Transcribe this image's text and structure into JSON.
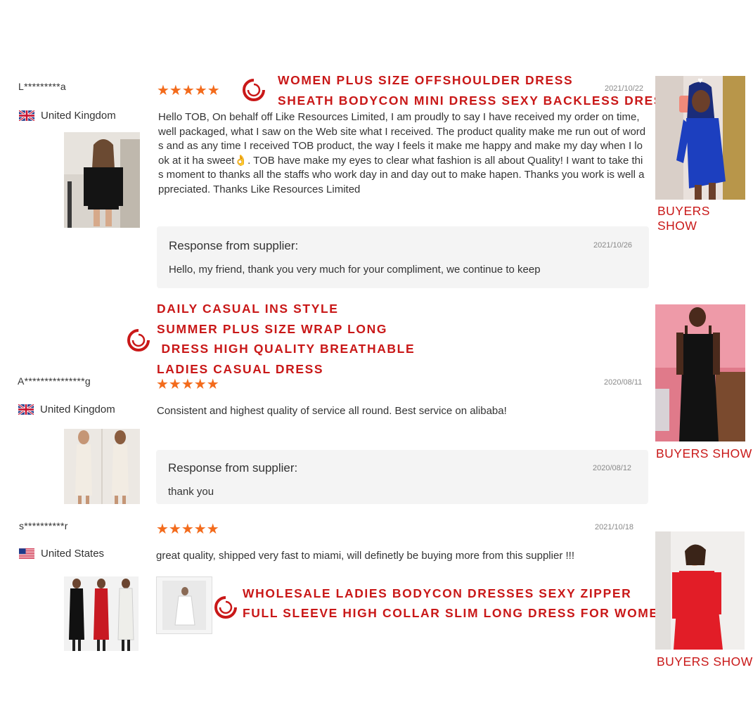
{
  "reviews": [
    {
      "reviewer": "L*********a",
      "country": "United Kingdom",
      "flag": "uk-flag-icon",
      "date": "2021/10/22",
      "text": "Hello TOB, On behalf off Like Resources Limited, I am proudly to say I have received my order on time, well packaged, what I saw on the Web site what I received. The product quality make me run out of words and as any time I received TOB product, the way I feels it make me happy and make my day when I look at it ha sweet👌. TOB have make my eyes to clear what fashion is all about Quality! I want to take this moment to thanks all the staffs who work day in and day out to make hapen. Thanks you work is well appreciated. Thanks Like Resources Limited",
      "response_title": "Response from supplier:",
      "response_date": "2021/10/26",
      "response_text": "Hello, my friend, thank you very much for your compliment, we continue to keep",
      "promo": [
        "WOMEN PLUS SIZE OFFSHOULDER DRESS",
        "SHEATH BODYCON MINI DRESS SEXY BACKLESS DRESS"
      ],
      "buyers_show": "BUYERS SHOW"
    },
    {
      "reviewer": "A***************g",
      "country": "United Kingdom",
      "flag": "uk-flag-icon",
      "date": "2020/08/11",
      "text": "Consistent and highest quality of service all round. Best service on alibaba!",
      "response_title": "Response from supplier:",
      "response_date": "2020/08/12",
      "response_text": "thank you",
      "promo": [
        "DAILY CASUAL INS STYLE",
        "SUMMER PLUS SIZE WRAP LONG",
        " DRESS HIGH QUALITY BREATHABLE",
        "LADIES CASUAL DRESS"
      ],
      "buyers_show": "BUYERS SHOW"
    },
    {
      "reviewer": "s**********r",
      "country": "United States",
      "flag": "us-flag-icon",
      "date": "2021/10/18",
      "text": "great quality, shipped very fast to miami, will definetly be buying more from this supplier !!!",
      "promo": [
        "WHOLESALE LADIES BODYCON DRESSES SEXY ZIPPER",
        "FULL SLEEVE HIGH COLLAR SLIM LONG DRESS FOR WOMEN"
      ],
      "buyers_show": "BUYERS SHOW"
    }
  ],
  "colors": {
    "accent": "#c91818",
    "star": "#f36b1c",
    "response_bg": "#f4f4f4"
  },
  "icons": {
    "rating": "star-icon",
    "swirl": "swirl-logo-icon"
  },
  "rating": {
    "stars": 5,
    "glyphs": "★★★★★"
  }
}
